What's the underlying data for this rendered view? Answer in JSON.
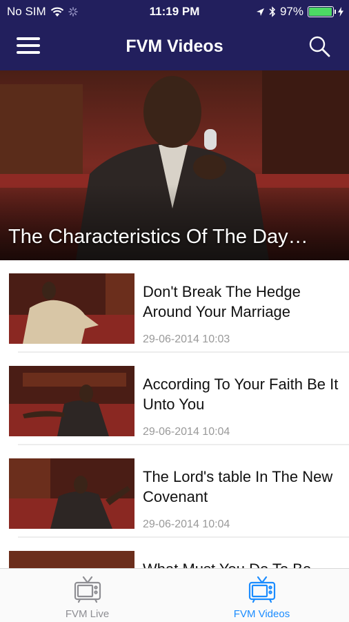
{
  "status_bar": {
    "carrier": "No SIM",
    "time": "11:19 PM",
    "battery": "97%",
    "battery_level": 0.97
  },
  "nav": {
    "title": "FVM Videos"
  },
  "featured": {
    "title": "The Characteristics Of The Day…"
  },
  "videos": [
    {
      "title": "Don't Break The Hedge Around Your Marriage",
      "date": "29-06-2014 10:03"
    },
    {
      "title": "According To Your Faith Be It Unto You",
      "date": "29-06-2014 10:04"
    },
    {
      "title": "The Lord's table In The New Covenant",
      "date": "29-06-2014 10:04"
    },
    {
      "title": "What Must You Do To Be",
      "date": ""
    }
  ],
  "tabs": [
    {
      "label": "FVM Live",
      "icon": "tv-icon",
      "active": false
    },
    {
      "label": "FVM Videos",
      "icon": "tv-icon",
      "active": true
    }
  ],
  "colors": {
    "header_bg": "#221f5d",
    "active_tab": "#1a8cff",
    "inactive_tab": "#8e8e93",
    "battery_fill": "#4cd964"
  }
}
